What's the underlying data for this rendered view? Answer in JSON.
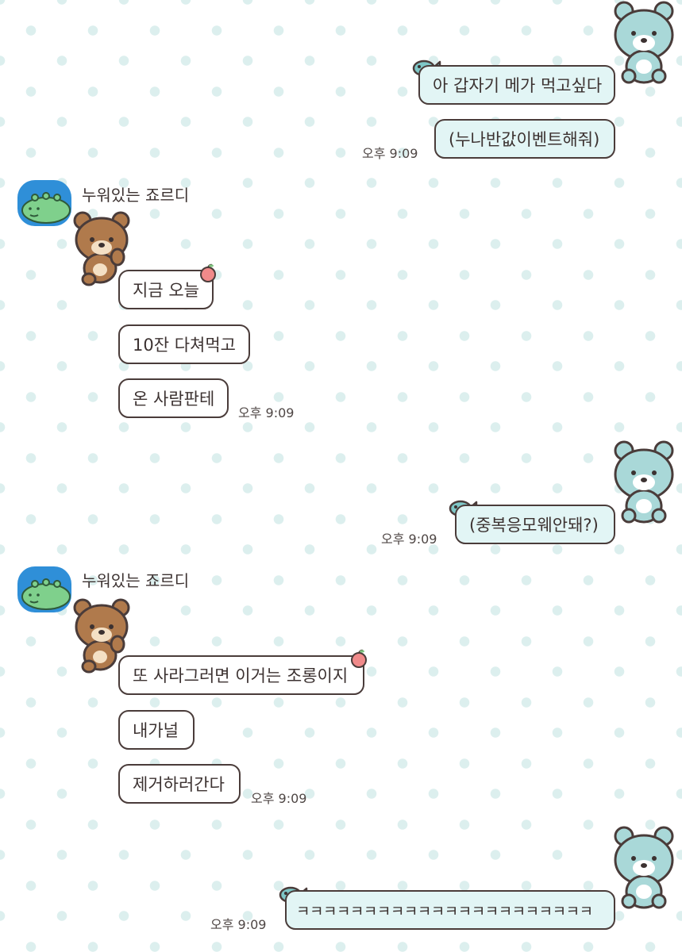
{
  "messages": [
    {
      "id": "m1",
      "side": "mine",
      "text": "아 갑자기 메가 먹고싶다"
    },
    {
      "id": "m2",
      "side": "mine",
      "text": "(누나반값이벤트해줘)",
      "time": "오후 9:09"
    },
    {
      "id": "m3",
      "side": "theirs",
      "sender": "누워있는 죠르디",
      "text": "지금 오늘"
    },
    {
      "id": "m4",
      "side": "theirs",
      "text": "10잔 다쳐먹고"
    },
    {
      "id": "m5",
      "side": "theirs",
      "text": "온 사람판테",
      "time": "오후 9:09"
    },
    {
      "id": "m6",
      "side": "mine",
      "text": "(중복응모웨안돼?)",
      "time": "오후 9:09"
    },
    {
      "id": "m7",
      "side": "theirs",
      "sender": "누워있는 죠르디",
      "text": "또 사라그러면 이거는 조롱이지"
    },
    {
      "id": "m8",
      "side": "theirs",
      "text": "내가널"
    },
    {
      "id": "m9",
      "side": "theirs",
      "text": "제거하러간다",
      "time": "오후 9:09"
    },
    {
      "id": "m10",
      "side": "mine",
      "text": "ㅋㅋㅋㅋㅋㅋㅋㅋㅋㅋㅋㅋㅋㅋㅋㅋㅋㅋㅋㅋㅋㅋ",
      "time": "오후 9:09"
    }
  ],
  "theme": {
    "bubble_mine": "#e2f5f5",
    "bubble_theirs": "#ffffff",
    "bubble_border": "#4a3c3a",
    "background_dot": "#dcefee",
    "avatar_bg": "#2f8fd8",
    "icons": [
      "mint-bear-sticker-icon",
      "brown-bear-sticker-icon",
      "fish-decoration-icon",
      "apple-decoration-icon",
      "jordy-avatar-icon"
    ]
  }
}
